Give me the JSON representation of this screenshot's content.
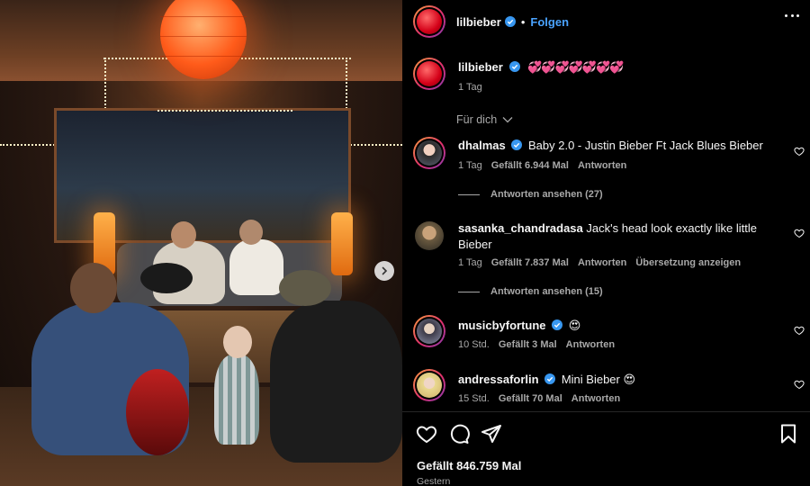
{
  "post": {
    "author": "lilbieber",
    "follow_label": "Folgen",
    "separator": "•",
    "caption_text": "💞💞💞💞💞💞💞",
    "caption_time": "1 Tag",
    "for_you_label": "Für dich",
    "likes": "Gefällt 846.759 Mal",
    "date": "Gestern"
  },
  "comments": [
    {
      "username": "dhalmas",
      "verified": true,
      "text": "Baby 2.0 - Justin Bieber Ft Jack Blues Bieber",
      "time": "1 Tag",
      "likes": "Gefällt 6.944 Mal",
      "reply": "Antworten",
      "view_replies": "Antworten ansehen (27)"
    },
    {
      "username": "sasanka_chandradasa",
      "verified": false,
      "text": "Jack's head look exactly like little Bieber",
      "time": "1 Tag",
      "likes": "Gefällt 7.837 Mal",
      "reply": "Antworten",
      "translate": "Übersetzung anzeigen",
      "view_replies": "Antworten ansehen (15)"
    },
    {
      "username": "musicbyfortune",
      "verified": true,
      "text": "😍",
      "time": "10 Std.",
      "likes": "Gefällt 3 Mal",
      "reply": "Antworten"
    },
    {
      "username": "andressaforlin",
      "verified": true,
      "text": "Mini Bieber 😍",
      "time": "15 Std.",
      "likes": "Gefällt 70 Mal",
      "reply": "Antworten"
    }
  ],
  "icons": {
    "more": "more-options-icon",
    "verified": "verified-badge-icon",
    "chevron": "chevron-down-icon",
    "like": "heart-icon",
    "comment": "comment-icon",
    "share": "share-icon",
    "save": "bookmark-icon",
    "next": "chevron-right-icon"
  },
  "colors": {
    "background": "#000000",
    "link": "#4aa3ff",
    "verified": "#3897f0",
    "secondary_text": "#a8a8a8"
  }
}
